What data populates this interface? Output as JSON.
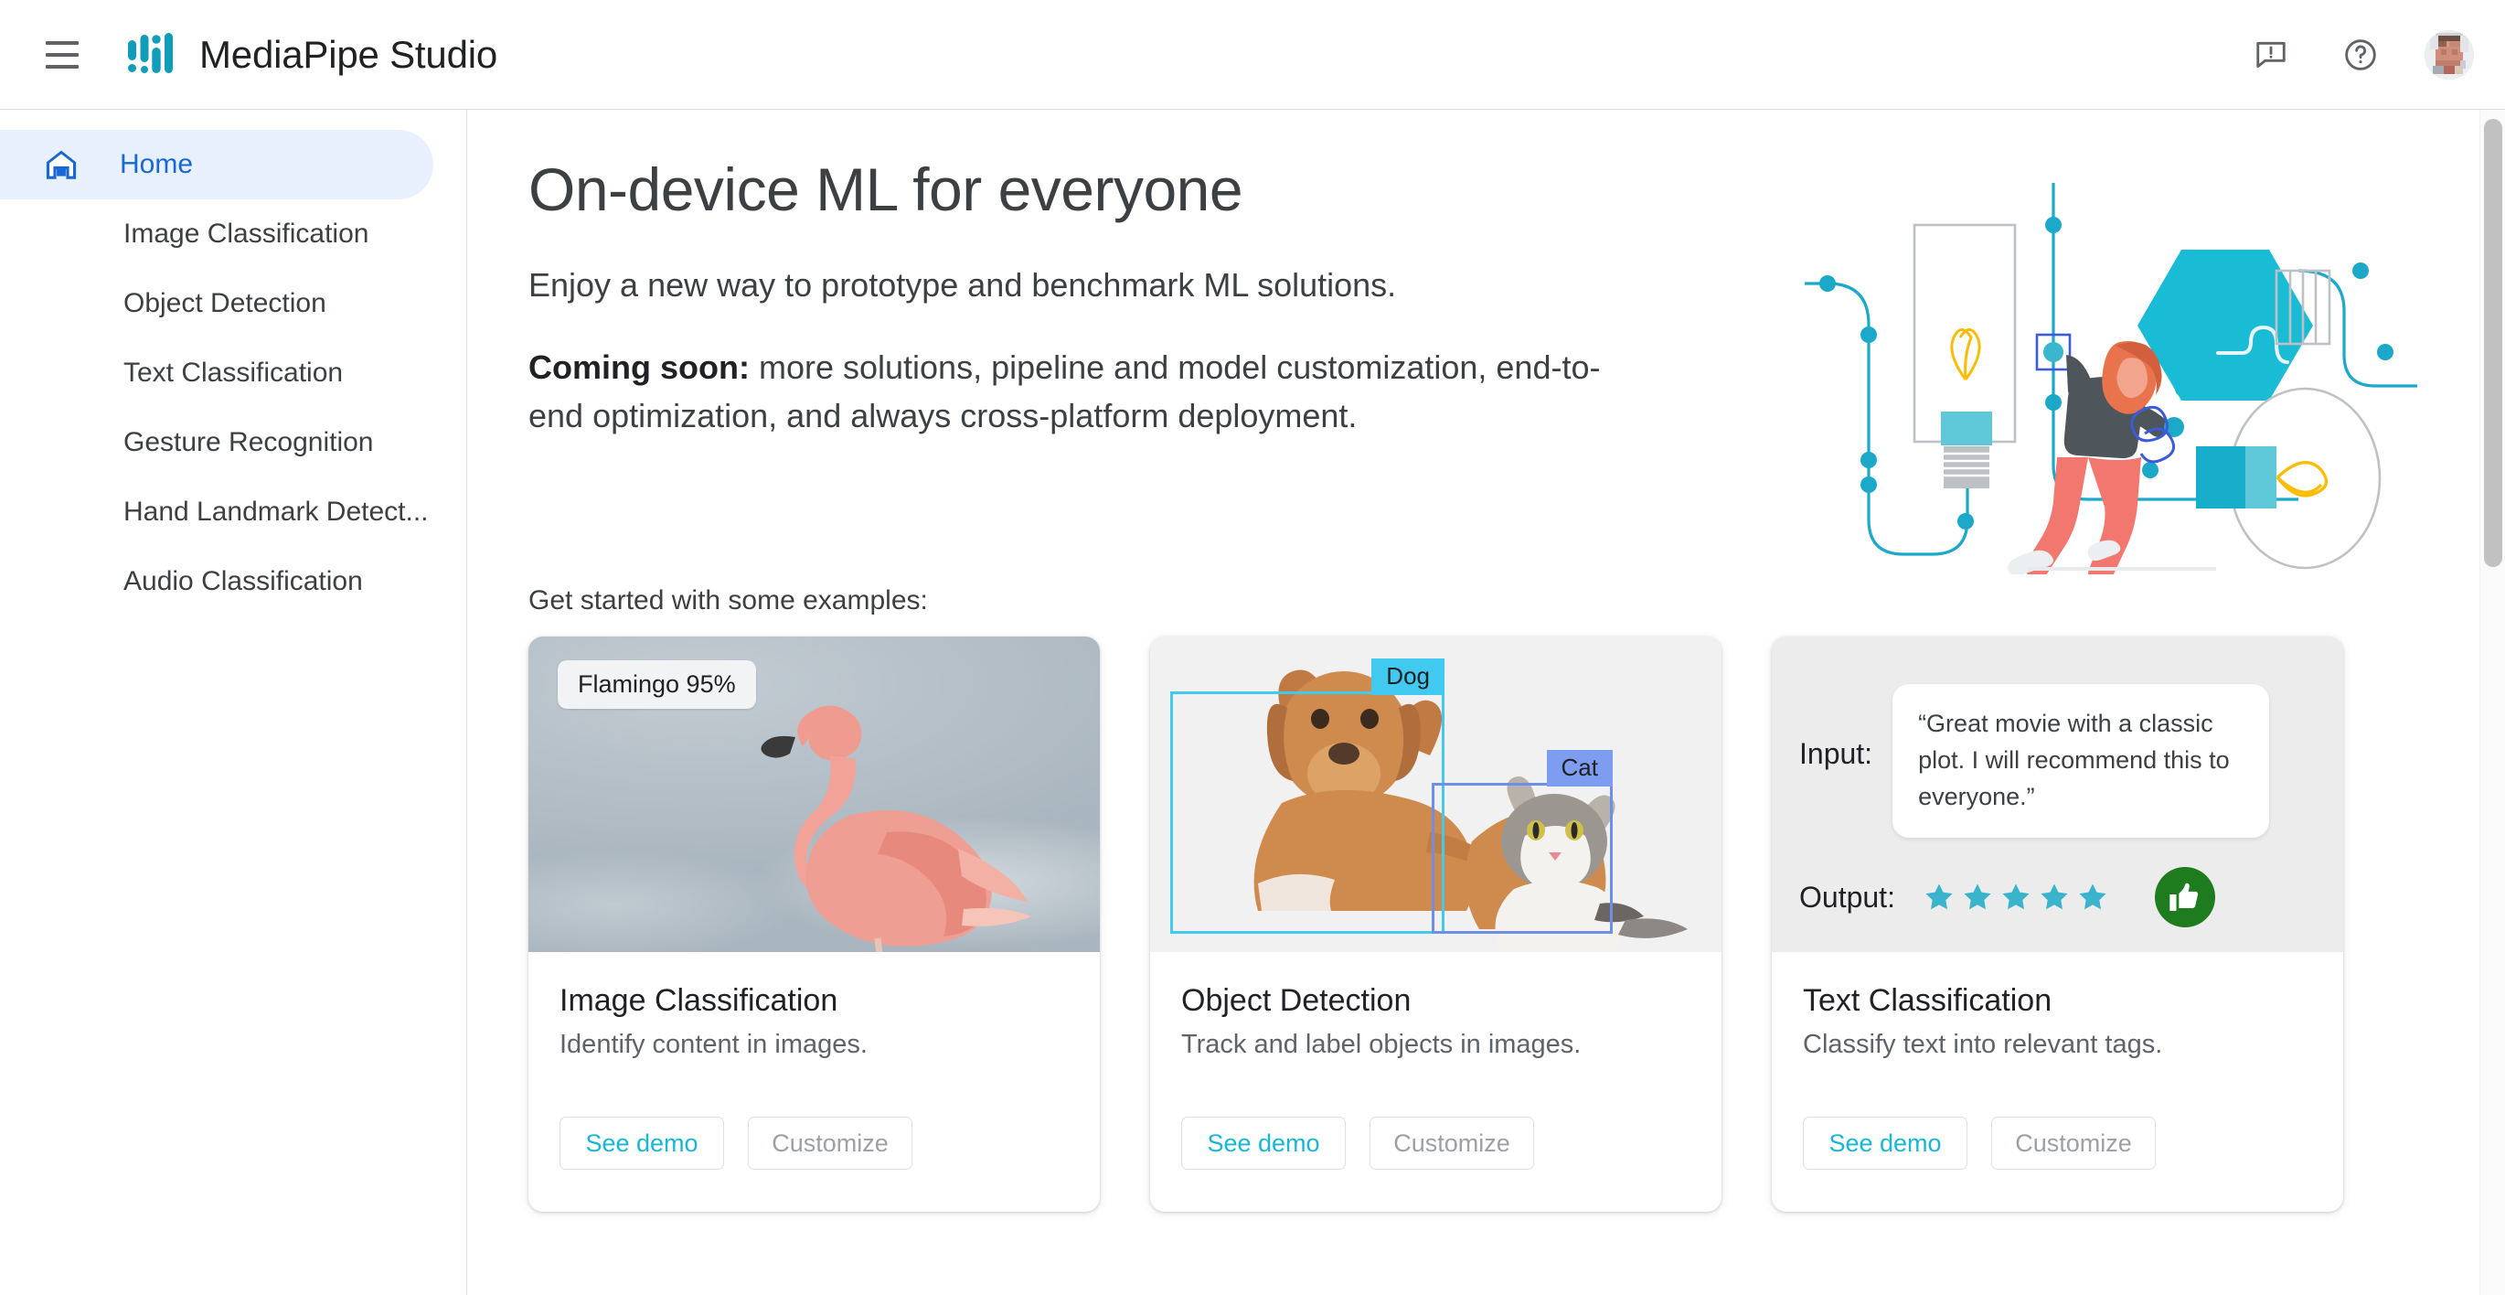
{
  "header": {
    "menu_icon": "hamburger-menu-icon",
    "logo_icon": "mediapipe-logo-icon",
    "title": "MediaPipe Studio",
    "feedback_icon": "feedback-icon",
    "help_icon": "help-icon",
    "avatar_icon": "user-avatar"
  },
  "sidebar": {
    "items": [
      {
        "label": "Home",
        "icon": "home-icon",
        "active": true
      },
      {
        "label": "Image Classification",
        "icon": "",
        "active": false
      },
      {
        "label": "Object Detection",
        "icon": "",
        "active": false
      },
      {
        "label": "Text Classification",
        "icon": "",
        "active": false
      },
      {
        "label": "Gesture Recognition",
        "icon": "",
        "active": false
      },
      {
        "label": "Hand Landmark Detect...",
        "icon": "",
        "active": false
      },
      {
        "label": "Audio Classification",
        "icon": "",
        "active": false
      }
    ]
  },
  "hero": {
    "title": "On-device ML for everyone",
    "subtitle": "Enjoy a new way to prototype and benchmark ML solutions.",
    "coming_soon_label": "Coming soon:",
    "coming_soon_text": " more solutions, pipeline and model customization, end-to-end optimization, and always cross-platform deployment.",
    "illustration_icon": "ml-workflow-illustration"
  },
  "examples": {
    "label": "Get started with some examples:",
    "cards": [
      {
        "title": "Image Classification",
        "description": "Identify content in images.",
        "demo_label": "See demo",
        "customize_label": "Customize",
        "media": {
          "type": "flamingo-photo",
          "pill_label": "Flamingo 95%"
        }
      },
      {
        "title": "Object Detection",
        "description": "Track and label objects in images.",
        "demo_label": "See demo",
        "customize_label": "Customize",
        "media": {
          "type": "dog-cat-photo",
          "box_labels": [
            "Dog",
            "Cat"
          ]
        }
      },
      {
        "title": "Text Classification",
        "description": "Classify text into relevant tags.",
        "demo_label": "See demo",
        "customize_label": "Customize",
        "media": {
          "type": "text-sentiment",
          "input_key": "Input:",
          "input_text": "“Great movie with a classic plot. I will recommend this to everyone.”",
          "output_key": "Output:",
          "stars": 5,
          "thumb_icon": "thumbs-up-icon"
        }
      }
    ]
  },
  "colors": {
    "brand_teal": "#0f9dba",
    "accent_cyan": "#17b7d4",
    "active_blue": "#1967d2",
    "active_blue_bg": "#e8f0fe",
    "text_primary": "#202124",
    "text_secondary": "#5f6368",
    "disabled_grey": "#9aa0a6",
    "star_teal": "#3ab4cc",
    "thumb_green": "#1e7b1e",
    "dog_box": "#41c9ef",
    "cat_box": "#7e9cf0"
  },
  "scrollbar": {
    "icon": "vertical-scrollbar"
  }
}
